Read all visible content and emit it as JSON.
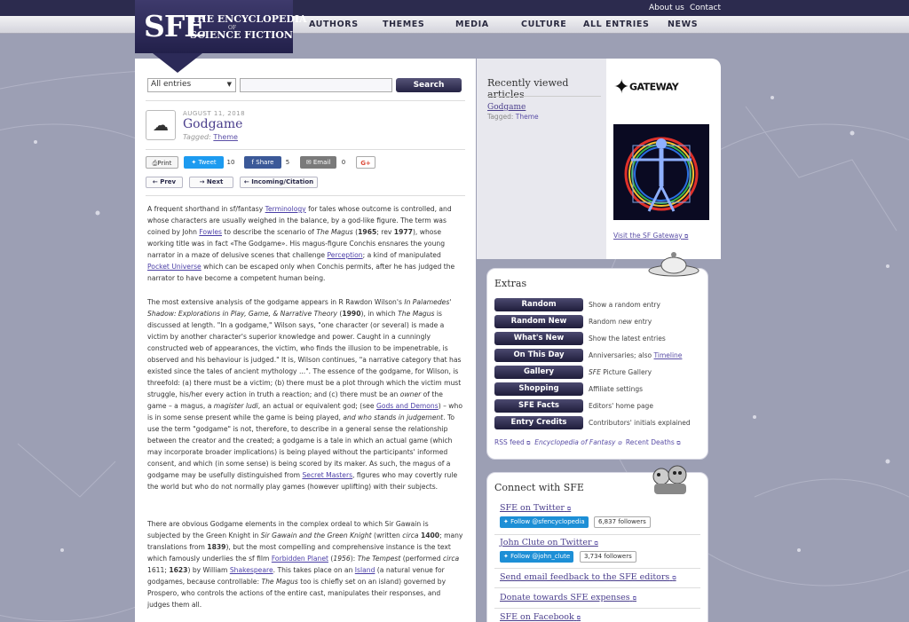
{
  "topbar": {
    "about": "About us",
    "contact": "Contact"
  },
  "logo": {
    "sfe": "SFE",
    "line1": "THE ENCYCLOPEDIA",
    "line2": "OF",
    "line3": "SCIENCE FICTION"
  },
  "nav": [
    "AUTHORS",
    "THEMES",
    "MEDIA",
    "CULTURE",
    "ALL ENTRIES",
    "NEWS"
  ],
  "search": {
    "filter": "All entries",
    "button": "Search"
  },
  "entry": {
    "date": "AUGUST 11, 2018",
    "title": "Godgame",
    "tagged_label": "Tagged:",
    "tag": "Theme"
  },
  "share": {
    "print": "Print",
    "tweet": "Tweet",
    "tweet_count": "10",
    "fb": "Share",
    "fb_count": "5",
    "email": "Email",
    "email_count": "0",
    "gplus": "G+"
  },
  "pager": {
    "prev": "Prev",
    "next": "Next",
    "incoming": "Incoming/Citation"
  },
  "article": {
    "p1": {
      "t1": "A frequent shorthand in sf/fantasy ",
      "a1": "Terminology",
      "t2": " for tales whose outcome is controlled, and whose characters are usually weighed in the balance, by a god-like figure. The term was coined by John ",
      "a2": "Fowles",
      "t3": " to describe the scenario of ",
      "i1": "The Magus",
      "t4": " (",
      "b1": "1965",
      "t5": "; rev ",
      "b2": "1977",
      "t6": "), whose working title was in fact «The Godgame». His magus-figure Conchis ensnares the young narrator in a maze of delusive scenes that challenge ",
      "a3": "Perception",
      "t7": "; a kind of manipulated ",
      "a4": "Pocket Universe",
      "t8": " which can be escaped only when Conchis permits, after he has judged the narrator to have become a competent human being."
    },
    "p2": {
      "t1": "The most extensive analysis of the godgame appears in R Rawdon Wilson's ",
      "i1": "In Palamedes' Shadow: Explorations in Play, Game, & Narrative Theory",
      "t2": " (",
      "b1": "1990",
      "t3": "), in which ",
      "i2": "The Magus",
      "t4": " is discussed at length. \"In a godgame,\" Wilson says, \"one character (or several) is made a victim by another character's superior knowledge and power. Caught in a cunningly constructed web of appearances, the victim, who finds the illusion to be impenetrable, is observed and his behaviour is judged.\" It is, Wilson continues, \"a narrative category that has existed since the tales of ancient mythology ...\". The essence of the godgame, for Wilson, is threefold: (a) there must be a victim; (b) there must be a plot through which the victim must struggle, his/her every action in truth a reaction; and (c) there must be an ",
      "i3": "owner",
      "t5": " of the game – a magus, a ",
      "i4": "magister ludi",
      "t6": ", an actual or equivalent god; (see ",
      "a1": "Gods and Demons",
      "t7": ") – who is in some sense present while the game is being played, ",
      "i5": "and who stands in judgement",
      "t8": ". To use the term \"godgame\" is not, therefore, to describe in a general sense the relationship between the creator and the created; a godgame is a tale in which an actual game (which may incorporate broader implications) is being played without the participants' informed consent, and which (in some sense) is being scored by its maker. As such, the magus of a godgame may be usefully distinguished from ",
      "a2": "Secret Masters",
      "t9": ", figures who may covertly rule the world but who do not normally play games (however uplifting) with their subjects."
    },
    "p3": {
      "t1": "There are obvious Godgame elements in the complex ordeal to which Sir Gawain is subjected by the Green Knight in ",
      "i1": "Sir Gawain and the Green Knight",
      "t2": " (written ",
      "i2": "circa",
      "t3": " ",
      "b1": "1400",
      "t4": "; many translations from ",
      "b2": "1839",
      "t5": "), but the most compelling and comprehensive instance is the text which famously underlies the sf film ",
      "a1": "Forbidden Planet",
      "t6": " (",
      "i3": "1956",
      "t7": "): ",
      "i4": "The Tempest",
      "t8": " (performed ",
      "i5": "circa",
      "t9": " 1611; ",
      "b3": "1623",
      "t10": ") by William ",
      "a2": "Shakespeare",
      "t11": ". This takes place on an ",
      "a3": "Island",
      "t12": " (a natural venue for godgames, because controllable: ",
      "i6": "The Magus",
      "t13": " too is chiefly set on an island) governed by Prospero, who controls the actions of the entire cast, manipulates their responses, and judges them all."
    }
  },
  "recent": {
    "heading": "Recently viewed articles",
    "article": "Godgame",
    "tagged": "Tagged:",
    "tag": "Theme"
  },
  "gateway": {
    "logo": "GATEWAY",
    "link": "Visit the SF Gateway"
  },
  "extras": {
    "heading": "Extras",
    "items": [
      {
        "label": "Random",
        "d1": "Show a random entry"
      },
      {
        "label": "Random New",
        "d1": "Random ",
        "di": "new",
        "d2": " entry"
      },
      {
        "label": "What's New",
        "d1": "Show the latest entries"
      },
      {
        "label": "On This Day",
        "d1": "Anniversaries; also ",
        "da": "Timeline"
      },
      {
        "label": "Gallery",
        "di": "SFE",
        "d2": " Picture Gallery"
      },
      {
        "label": "Shopping",
        "d1": "Affiliate settings"
      },
      {
        "label": "SFE Facts",
        "d1": "Editors' home page"
      },
      {
        "label": "Entry Credits",
        "d1": "Contributors' initials explained"
      }
    ],
    "links": {
      "rss": "RSS feed",
      "eof": "Encyclopedia of Fantasy",
      "deaths": "Recent Deaths"
    }
  },
  "connect": {
    "heading": "Connect with SFE",
    "twitter1": "SFE on Twitter",
    "follow1": "Follow @sfencyclopedia",
    "followers1": "6,837 followers",
    "twitter2": "John Clute on Twitter",
    "follow2": "Follow @john_clute",
    "followers2": "3,734 followers",
    "feedback": "Send email feedback to the SFE editors",
    "donate": "Donate towards SFE expenses",
    "facebook": "SFE on Facebook"
  }
}
